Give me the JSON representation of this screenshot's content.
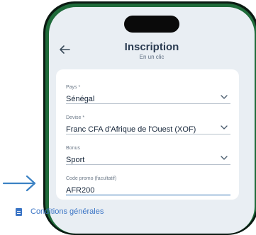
{
  "header": {
    "title": "Inscription",
    "subtitle": "En un clic"
  },
  "form": {
    "country": {
      "label": "Pays *",
      "value": "Sénégal"
    },
    "currency": {
      "label": "Devise *",
      "value": "Franc CFA d'Afrique de l'Ouest (XOF)"
    },
    "bonus": {
      "label": "Bonus",
      "value": "Sport"
    },
    "promo": {
      "label": "Code promo (facultatif)",
      "value": "AFR200"
    }
  },
  "conditions": {
    "label": "Conditions générales"
  },
  "icons": {
    "back": "arrow-left-icon",
    "dropdown": "chevron-down-icon",
    "document": "document-icon",
    "pointer": "arrow-right-icon"
  },
  "colors": {
    "phone_accent": "#1f6b3a",
    "link_blue": "#3a74c5",
    "active_underline": "#2a6fb0",
    "pointer_arrow": "#3b82c4"
  }
}
